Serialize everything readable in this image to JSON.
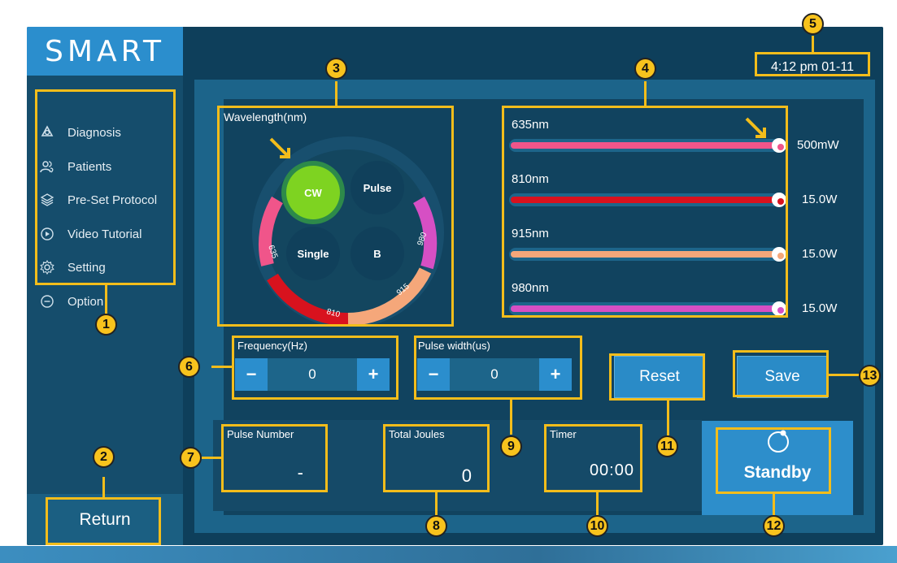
{
  "app": {
    "logo": "SMART",
    "datetime": "4:12 pm 01-11"
  },
  "sidebar": {
    "items": [
      {
        "label": "Diagnosis",
        "icon": "diagnosis-icon"
      },
      {
        "label": "Patients",
        "icon": "patients-icon"
      },
      {
        "label": "Pre-Set Protocol",
        "icon": "layers-icon"
      },
      {
        "label": "Video Tutorial",
        "icon": "play-icon"
      },
      {
        "label": "Setting",
        "icon": "gear-icon"
      },
      {
        "label": "Option",
        "icon": "minus-circle-icon"
      }
    ],
    "return_label": "Return"
  },
  "wavelength": {
    "title": "Wavelength(nm)",
    "modes": [
      "CW",
      "Pulse",
      "Single",
      "B"
    ],
    "active_mode": "CW",
    "ring_labels": [
      "635",
      "810",
      "915",
      "980"
    ]
  },
  "sliders": [
    {
      "label": "635nm",
      "power": "500mW",
      "color": "#f0558a",
      "level": 1.0
    },
    {
      "label": "810nm",
      "power": "15.0W",
      "color": "#d8121e",
      "level": 1.0
    },
    {
      "label": "915nm",
      "power": "15.0W",
      "color": "#f5a77a",
      "level": 1.0
    },
    {
      "label": "980nm",
      "power": "15.0W",
      "color": "#d64fc4",
      "level": 1.0
    }
  ],
  "frequency": {
    "label": "Frequency(Hz)",
    "value": "0",
    "minus": "−",
    "plus": "+"
  },
  "pulse_width": {
    "label": "Pulse width(us)",
    "value": "0",
    "minus": "−",
    "plus": "+"
  },
  "buttons": {
    "reset": "Reset",
    "save": "Save",
    "standby": "Standby"
  },
  "stats": {
    "pulse_number_label": "Pulse Number",
    "pulse_number": "-",
    "total_joules_label": "Total Joules",
    "total_joules": "0",
    "timer_label": "Timer",
    "timer": "00:00"
  },
  "callouts": [
    "1",
    "2",
    "3",
    "4",
    "5",
    "6",
    "7",
    "8",
    "9",
    "10",
    "11",
    "12",
    "13"
  ],
  "colors": {
    "accent": "#2b8ecd",
    "annotation": "#f3bd1b",
    "cw_active": "#7ed321"
  }
}
